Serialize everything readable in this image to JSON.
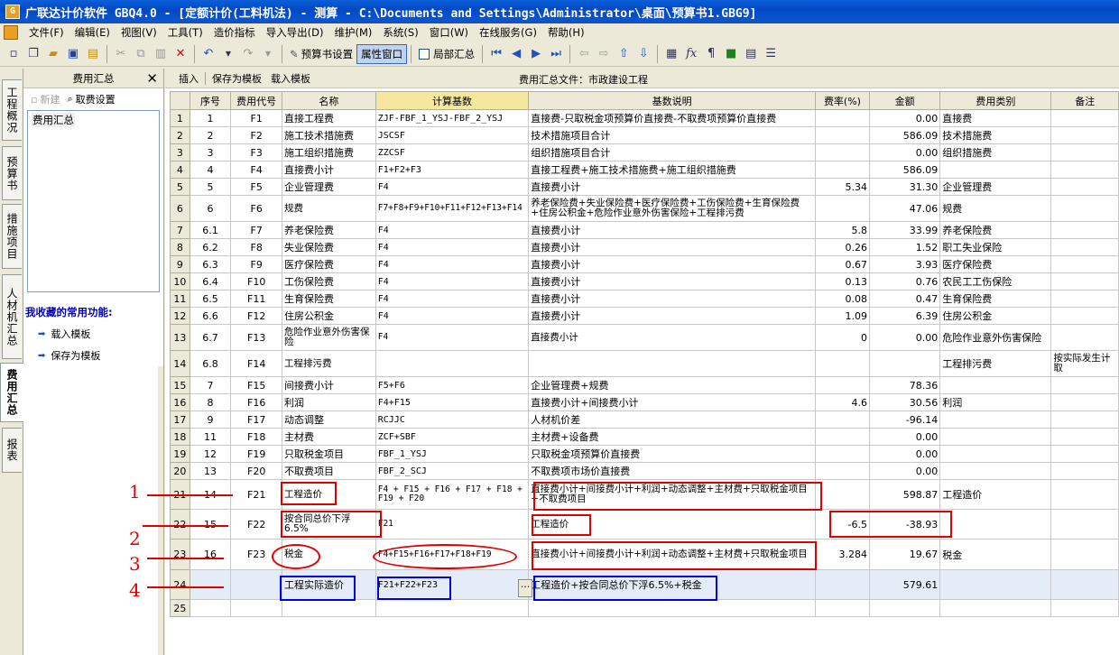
{
  "window": {
    "title": "广联达计价软件 GBQ4.0 - [定额计价(工料机法) - 测算 - C:\\Documents and Settings\\Administrator\\桌面\\预算书1.GBG9]"
  },
  "menu": [
    "文件(F)",
    "编辑(E)",
    "视图(V)",
    "工具(T)",
    "造价指标",
    "导入导出(D)",
    "维护(M)",
    "系统(S)",
    "窗口(W)",
    "在线服务(G)",
    "帮助(H)"
  ],
  "toolbar": {
    "budget_settings": "预算书设置",
    "property_window": "属性窗口",
    "local_summary": "局部汇总"
  },
  "vtabs": [
    "工程概况",
    "预算书",
    "措施项目",
    "人材机汇总",
    "费用汇总",
    "报表"
  ],
  "left_panel": {
    "title": "费用汇总",
    "new_label": "新建",
    "fee_setting_label": "取费设置",
    "tree_item": "费用汇总",
    "favorites_title": "我收藏的常用功能:",
    "favorites": [
      "载入模板",
      "保存为模板"
    ]
  },
  "main_toolbar": {
    "insert": "插入",
    "save_template": "保存为模板",
    "load_template": "载入模板",
    "file_label": "费用汇总文件：市政建设工程"
  },
  "table": {
    "headers": [
      "",
      "序号",
      "费用代号",
      "名称",
      "计算基数",
      "基数说明",
      "费率(%)",
      "金额",
      "费用类别",
      "备注"
    ],
    "rows": [
      [
        "1",
        "1",
        "F1",
        "直接工程费",
        "ZJF-FBF_1_YSJ-FBF_2_YSJ",
        "直接费-只取税金项预算价直接费-不取费项预算价直接费",
        "",
        "0.00",
        "直接费",
        ""
      ],
      [
        "2",
        "2",
        "F2",
        "施工技术措施费",
        "JSCSF",
        "技术措施项目合计",
        "",
        "586.09",
        "技术措施费",
        ""
      ],
      [
        "3",
        "3",
        "F3",
        "施工组织措施费",
        "ZZCSF",
        "组织措施项目合计",
        "",
        "0.00",
        "组织措施费",
        ""
      ],
      [
        "4",
        "4",
        "F4",
        "直接费小计",
        "F1+F2+F3",
        "直接工程费+施工技术措施费+施工组织措施费",
        "",
        "586.09",
        "",
        ""
      ],
      [
        "5",
        "5",
        "F5",
        "企业管理费",
        "F4",
        "直接费小计",
        "5.34",
        "31.30",
        "企业管理费",
        ""
      ],
      [
        "6",
        "6",
        "F6",
        "规费",
        "F7+F8+F9+F10+F11+F12+F13+F14",
        "养老保险费+失业保险费+医疗保险费+工伤保险费+生育保险费+住房公积金+危险作业意外伤害保险+工程排污费",
        "",
        "47.06",
        "规费",
        ""
      ],
      [
        "7",
        "6.1",
        "F7",
        "养老保险费",
        "F4",
        "直接费小计",
        "5.8",
        "33.99",
        "养老保险费",
        ""
      ],
      [
        "8",
        "6.2",
        "F8",
        "失业保险费",
        "F4",
        "直接费小计",
        "0.26",
        "1.52",
        "职工失业保险",
        ""
      ],
      [
        "9",
        "6.3",
        "F9",
        "医疗保险费",
        "F4",
        "直接费小计",
        "0.67",
        "3.93",
        "医疗保险费",
        ""
      ],
      [
        "10",
        "6.4",
        "F10",
        "工伤保险费",
        "F4",
        "直接费小计",
        "0.13",
        "0.76",
        "农民工工伤保险",
        ""
      ],
      [
        "11",
        "6.5",
        "F11",
        "生育保险费",
        "F4",
        "直接费小计",
        "0.08",
        "0.47",
        "生育保险费",
        ""
      ],
      [
        "12",
        "6.6",
        "F12",
        "住房公积金",
        "F4",
        "直接费小计",
        "1.09",
        "6.39",
        "住房公积金",
        ""
      ],
      [
        "13",
        "6.7",
        "F13",
        "危险作业意外伤害保险",
        "F4",
        "直接费小计",
        "0",
        "0.00",
        "危险作业意外伤害保险",
        ""
      ],
      [
        "14",
        "6.8",
        "F14",
        "工程排污费",
        "",
        "",
        "",
        "",
        "工程排污费",
        "按实际发生计取"
      ],
      [
        "15",
        "7",
        "F15",
        "间接费小计",
        "F5+F6",
        "企业管理费+规费",
        "",
        "78.36",
        "",
        ""
      ],
      [
        "16",
        "8",
        "F16",
        "利润",
        "F4+F15",
        "直接费小计+间接费小计",
        "4.6",
        "30.56",
        "利润",
        ""
      ],
      [
        "17",
        "9",
        "F17",
        "动态调整",
        "RCJJC",
        "人材机价差",
        "",
        "-96.14",
        "",
        ""
      ],
      [
        "18",
        "11",
        "F18",
        "主材费",
        "ZCF+SBF",
        "主材费+设备费",
        "",
        "0.00",
        "",
        ""
      ],
      [
        "19",
        "12",
        "F19",
        "只取税金项目",
        "FBF_1_YSJ",
        "只取税金项预算价直接费",
        "",
        "0.00",
        "",
        ""
      ],
      [
        "20",
        "13",
        "F20",
        "不取费项目",
        "FBF_2_SCJ",
        "不取费项市场价直接费",
        "",
        "0.00",
        "",
        ""
      ],
      [
        "21",
        "14",
        "F21",
        "工程造价",
        "F4 + F15 + F16 + F17 + F18 + F19 + F20",
        "直接费小计+间接费小计+利润+动态调整+主材费+只取税金项目+不取费项目",
        "",
        "598.87",
        "工程造价",
        ""
      ],
      [
        "22",
        "15",
        "F22",
        "按合同总价下浮6.5%",
        "F21",
        "工程造价",
        "-6.5",
        "-38.93",
        "",
        ""
      ],
      [
        "23",
        "16",
        "F23",
        "税金",
        "F4+F15+F16+F17+F18+F19",
        "直接费小计+间接费小计+利润+动态调整+主材费+只取税金项目",
        "3.284",
        "19.67",
        "税金",
        ""
      ],
      [
        "24",
        "",
        "",
        "工程实际造价",
        "F21+F22+F23",
        "工程造价+按合同总价下浮6.5%+税金",
        "",
        "579.61",
        "",
        ""
      ],
      [
        "25",
        "",
        "",
        "",
        "",
        "",
        "",
        "",
        "",
        ""
      ]
    ]
  },
  "annotations": {
    "labels": [
      "1",
      "2",
      "3",
      "4"
    ],
    "ellipsis": "···"
  },
  "colors": {
    "title_bar": "#0348c4",
    "annotation_red": "#e00000",
    "annotation_blue": "#0000e0",
    "highlight_header": "#f5e6a0"
  }
}
